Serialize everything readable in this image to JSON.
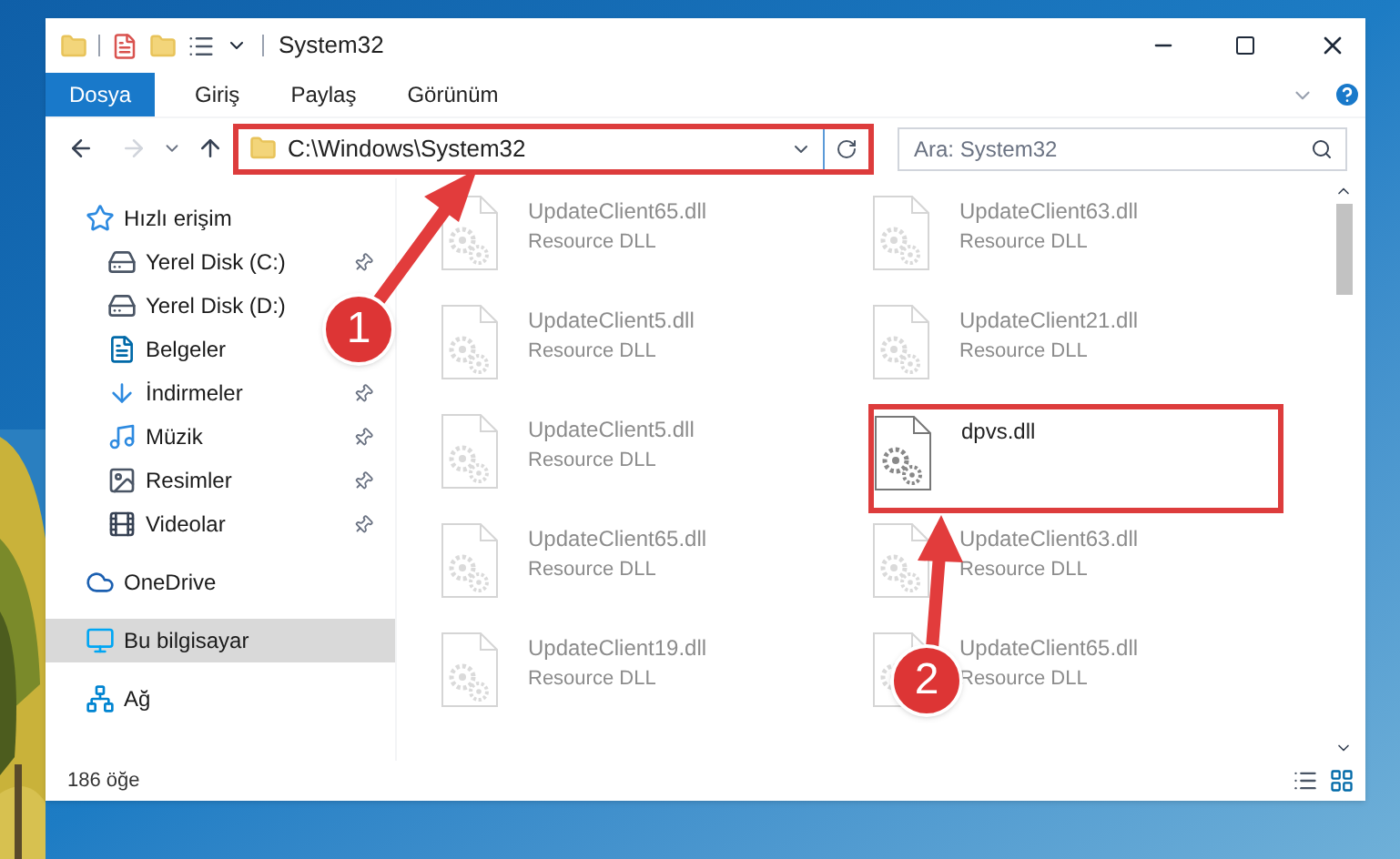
{
  "window": {
    "title": "System32"
  },
  "ribbon_tabs": [
    {
      "label": "Dosya",
      "selected": true
    },
    {
      "label": "Giriş",
      "selected": false
    },
    {
      "label": "Paylaş",
      "selected": false
    },
    {
      "label": "Görünüm",
      "selected": false
    }
  ],
  "address_bar": {
    "path": "C:\\Windows\\System32",
    "highlighted": true
  },
  "search": {
    "placeholder": "Ara: System32"
  },
  "sidebar": {
    "items": [
      {
        "label": "Hızlı erişim",
        "selected": false,
        "children": [
          {
            "label": "Yerel Disk (C:)",
            "selected": false,
            "pinned": true
          },
          {
            "label": "Yerel Disk (D:)",
            "selected": false
          },
          {
            "label": "Belgeler",
            "selected": false
          },
          {
            "label": "İndirmeler",
            "selected": false,
            "pinned": true
          },
          {
            "label": "Müzik",
            "selected": false,
            "pinned": true
          },
          {
            "label": "Resimler",
            "selected": false,
            "pinned": true
          },
          {
            "label": "Videolar",
            "selected": false,
            "pinned": true
          }
        ]
      },
      {
        "label": "OneDrive",
        "selected": false
      },
      {
        "label": "Bu bilgisayar",
        "selected": true
      },
      {
        "label": "Ağ",
        "selected": false
      }
    ]
  },
  "files": [
    {
      "name": "UpdateClient65.dll",
      "type": "Resource DLL",
      "dimmed": true,
      "highlighted": false
    },
    {
      "name": "UpdateClient63.dll",
      "type": "Resource DLL",
      "dimmed": true,
      "highlighted": false
    },
    {
      "name": "UpdateClient5.dll",
      "type": "Resource DLL",
      "dimmed": true,
      "highlighted": false
    },
    {
      "name": "UpdateClient21.dll",
      "type": "Resource DLL",
      "dimmed": true,
      "highlighted": false
    },
    {
      "name": "UpdateClient5.dll",
      "type": "Resource DLL",
      "dimmed": true,
      "highlighted": false
    },
    {
      "name": "dpvs.dll",
      "dimmed": false,
      "highlighted": true
    },
    {
      "name": "UpdateClient65.dll",
      "type": "Resource DLL",
      "dimmed": true,
      "highlighted": false
    },
    {
      "name": "UpdateClient63.dll",
      "type": "Resource DLL",
      "dimmed": true,
      "highlighted": false
    },
    {
      "name": "UpdateClient19.dll",
      "type": "Resource DLL",
      "dimmed": true,
      "highlighted": false
    },
    {
      "name": "UpdateClient65.dll",
      "type": "Resource DLL",
      "dimmed": true,
      "highlighted": false
    }
  ],
  "status_bar": {
    "count": "186 öğe"
  },
  "annotations": [
    {
      "number": "1"
    },
    {
      "number": "2"
    }
  ]
}
